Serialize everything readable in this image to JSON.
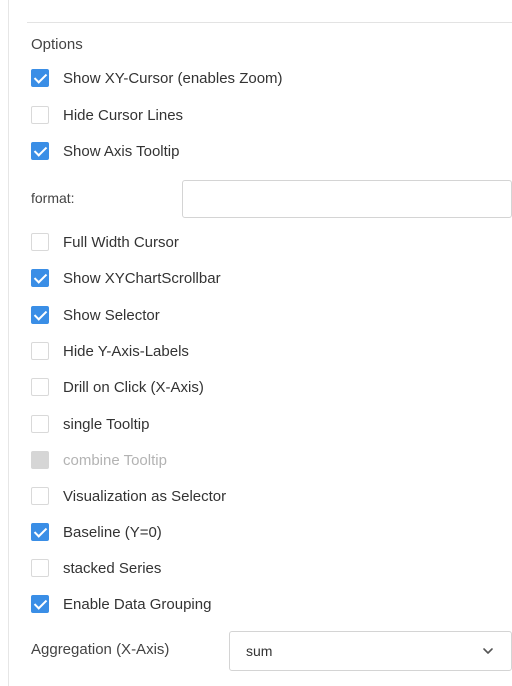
{
  "options_section": {
    "title": "Options",
    "items": [
      {
        "label": "Show XY-Cursor (enables Zoom)",
        "checked": true,
        "disabled": false
      },
      {
        "label": "Hide Cursor Lines",
        "checked": false,
        "disabled": false
      },
      {
        "label": "Show Axis Tooltip",
        "checked": true,
        "disabled": false
      },
      {
        "label": "Full Width Cursor",
        "checked": false,
        "disabled": false
      },
      {
        "label": "Show XYChartScrollbar",
        "checked": true,
        "disabled": false
      },
      {
        "label": "Show Selector",
        "checked": true,
        "disabled": false
      },
      {
        "label": "Hide Y-Axis-Labels",
        "checked": false,
        "disabled": false
      },
      {
        "label": "Drill on Click (X-Axis)",
        "checked": false,
        "disabled": false
      },
      {
        "label": "single Tooltip",
        "checked": false,
        "disabled": false
      },
      {
        "label": "combine Tooltip",
        "checked": false,
        "disabled": true
      },
      {
        "label": "Visualization as Selector",
        "checked": false,
        "disabled": false
      },
      {
        "label": "Baseline (Y=0)",
        "checked": true,
        "disabled": false
      },
      {
        "label": "stacked Series",
        "checked": false,
        "disabled": false
      },
      {
        "label": "Enable Data Grouping",
        "checked": true,
        "disabled": false
      }
    ]
  },
  "format_field": {
    "label": "format:",
    "value": ""
  },
  "aggregation": {
    "label": "Aggregation (X-Axis)",
    "selected": "sum"
  },
  "colors": {
    "accent": "#3a8ee6",
    "disabled": "#d6d6d6"
  },
  "icons": {
    "select_arrow": "chevron-down-icon"
  }
}
